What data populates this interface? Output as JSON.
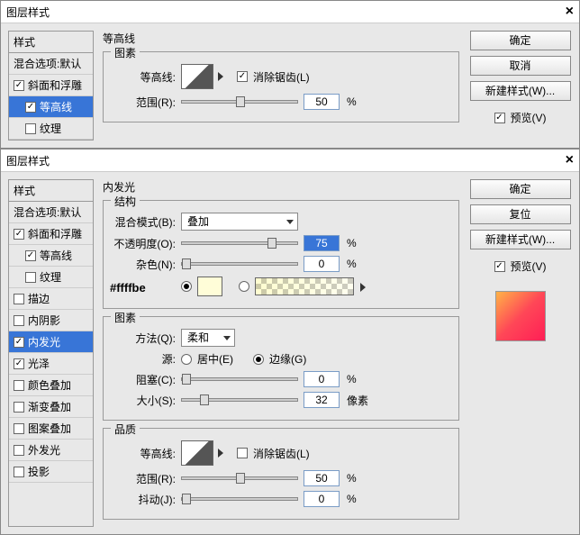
{
  "d1": {
    "title": "图层样式",
    "sidebar": {
      "head": "样式",
      "sub": "混合选项:默认",
      "items": [
        {
          "label": "斜面和浮雕",
          "on": true,
          "sel": false,
          "indent": false
        },
        {
          "label": "等高线",
          "on": true,
          "sel": true,
          "indent": true
        },
        {
          "label": "纹理",
          "on": false,
          "sel": false,
          "indent": true
        }
      ]
    },
    "section": "等高线",
    "group": "图素",
    "contour_lbl": "等高线:",
    "antialias": "消除锯齿(L)",
    "range_lbl": "范围(R):",
    "range_val": "50",
    "pct": "%",
    "btn_ok": "确定",
    "btn_cancel": "取消",
    "btn_new": "新建样式(W)...",
    "preview": "预览(V)"
  },
  "d2": {
    "title": "图层样式",
    "sidebar": {
      "head": "样式",
      "sub": "混合选项:默认",
      "items": [
        {
          "label": "斜面和浮雕",
          "on": true,
          "indent": false
        },
        {
          "label": "等高线",
          "on": true,
          "indent": true
        },
        {
          "label": "纹理",
          "on": false,
          "indent": true
        },
        {
          "label": "描边",
          "on": false,
          "indent": false
        },
        {
          "label": "内阴影",
          "on": false,
          "indent": false
        },
        {
          "label": "内发光",
          "on": true,
          "indent": false,
          "sel": true
        },
        {
          "label": "光泽",
          "on": true,
          "indent": false
        },
        {
          "label": "颜色叠加",
          "on": false,
          "indent": false
        },
        {
          "label": "渐变叠加",
          "on": false,
          "indent": false
        },
        {
          "label": "图案叠加",
          "on": false,
          "indent": false
        },
        {
          "label": "外发光",
          "on": false,
          "indent": false
        },
        {
          "label": "投影",
          "on": false,
          "indent": false
        }
      ]
    },
    "hex": "#ffffbe",
    "section": "内发光",
    "g_struct": "结构",
    "g_elem": "图素",
    "g_qual": "品质",
    "blend_lbl": "混合模式(B):",
    "blend_val": "叠加",
    "opacity_lbl": "不透明度(O):",
    "opacity_val": "75",
    "noise_lbl": "杂色(N):",
    "noise_val": "0",
    "method_lbl": "方法(Q):",
    "method_val": "柔和",
    "source_lbl": "源:",
    "src_center": "居中(E)",
    "src_edge": "边缘(G)",
    "choke_lbl": "阻塞(C):",
    "choke_val": "0",
    "size_lbl": "大小(S):",
    "size_val": "32",
    "px": "像素",
    "contour_lbl": "等高线:",
    "antialias": "消除锯齿(L)",
    "range_lbl": "范围(R):",
    "range_val": "50",
    "jitter_lbl": "抖动(J):",
    "jitter_val": "0",
    "pct": "%",
    "btn_ok": "确定",
    "btn_reset": "复位",
    "btn_new": "新建样式(W)...",
    "preview": "预览(V)"
  }
}
